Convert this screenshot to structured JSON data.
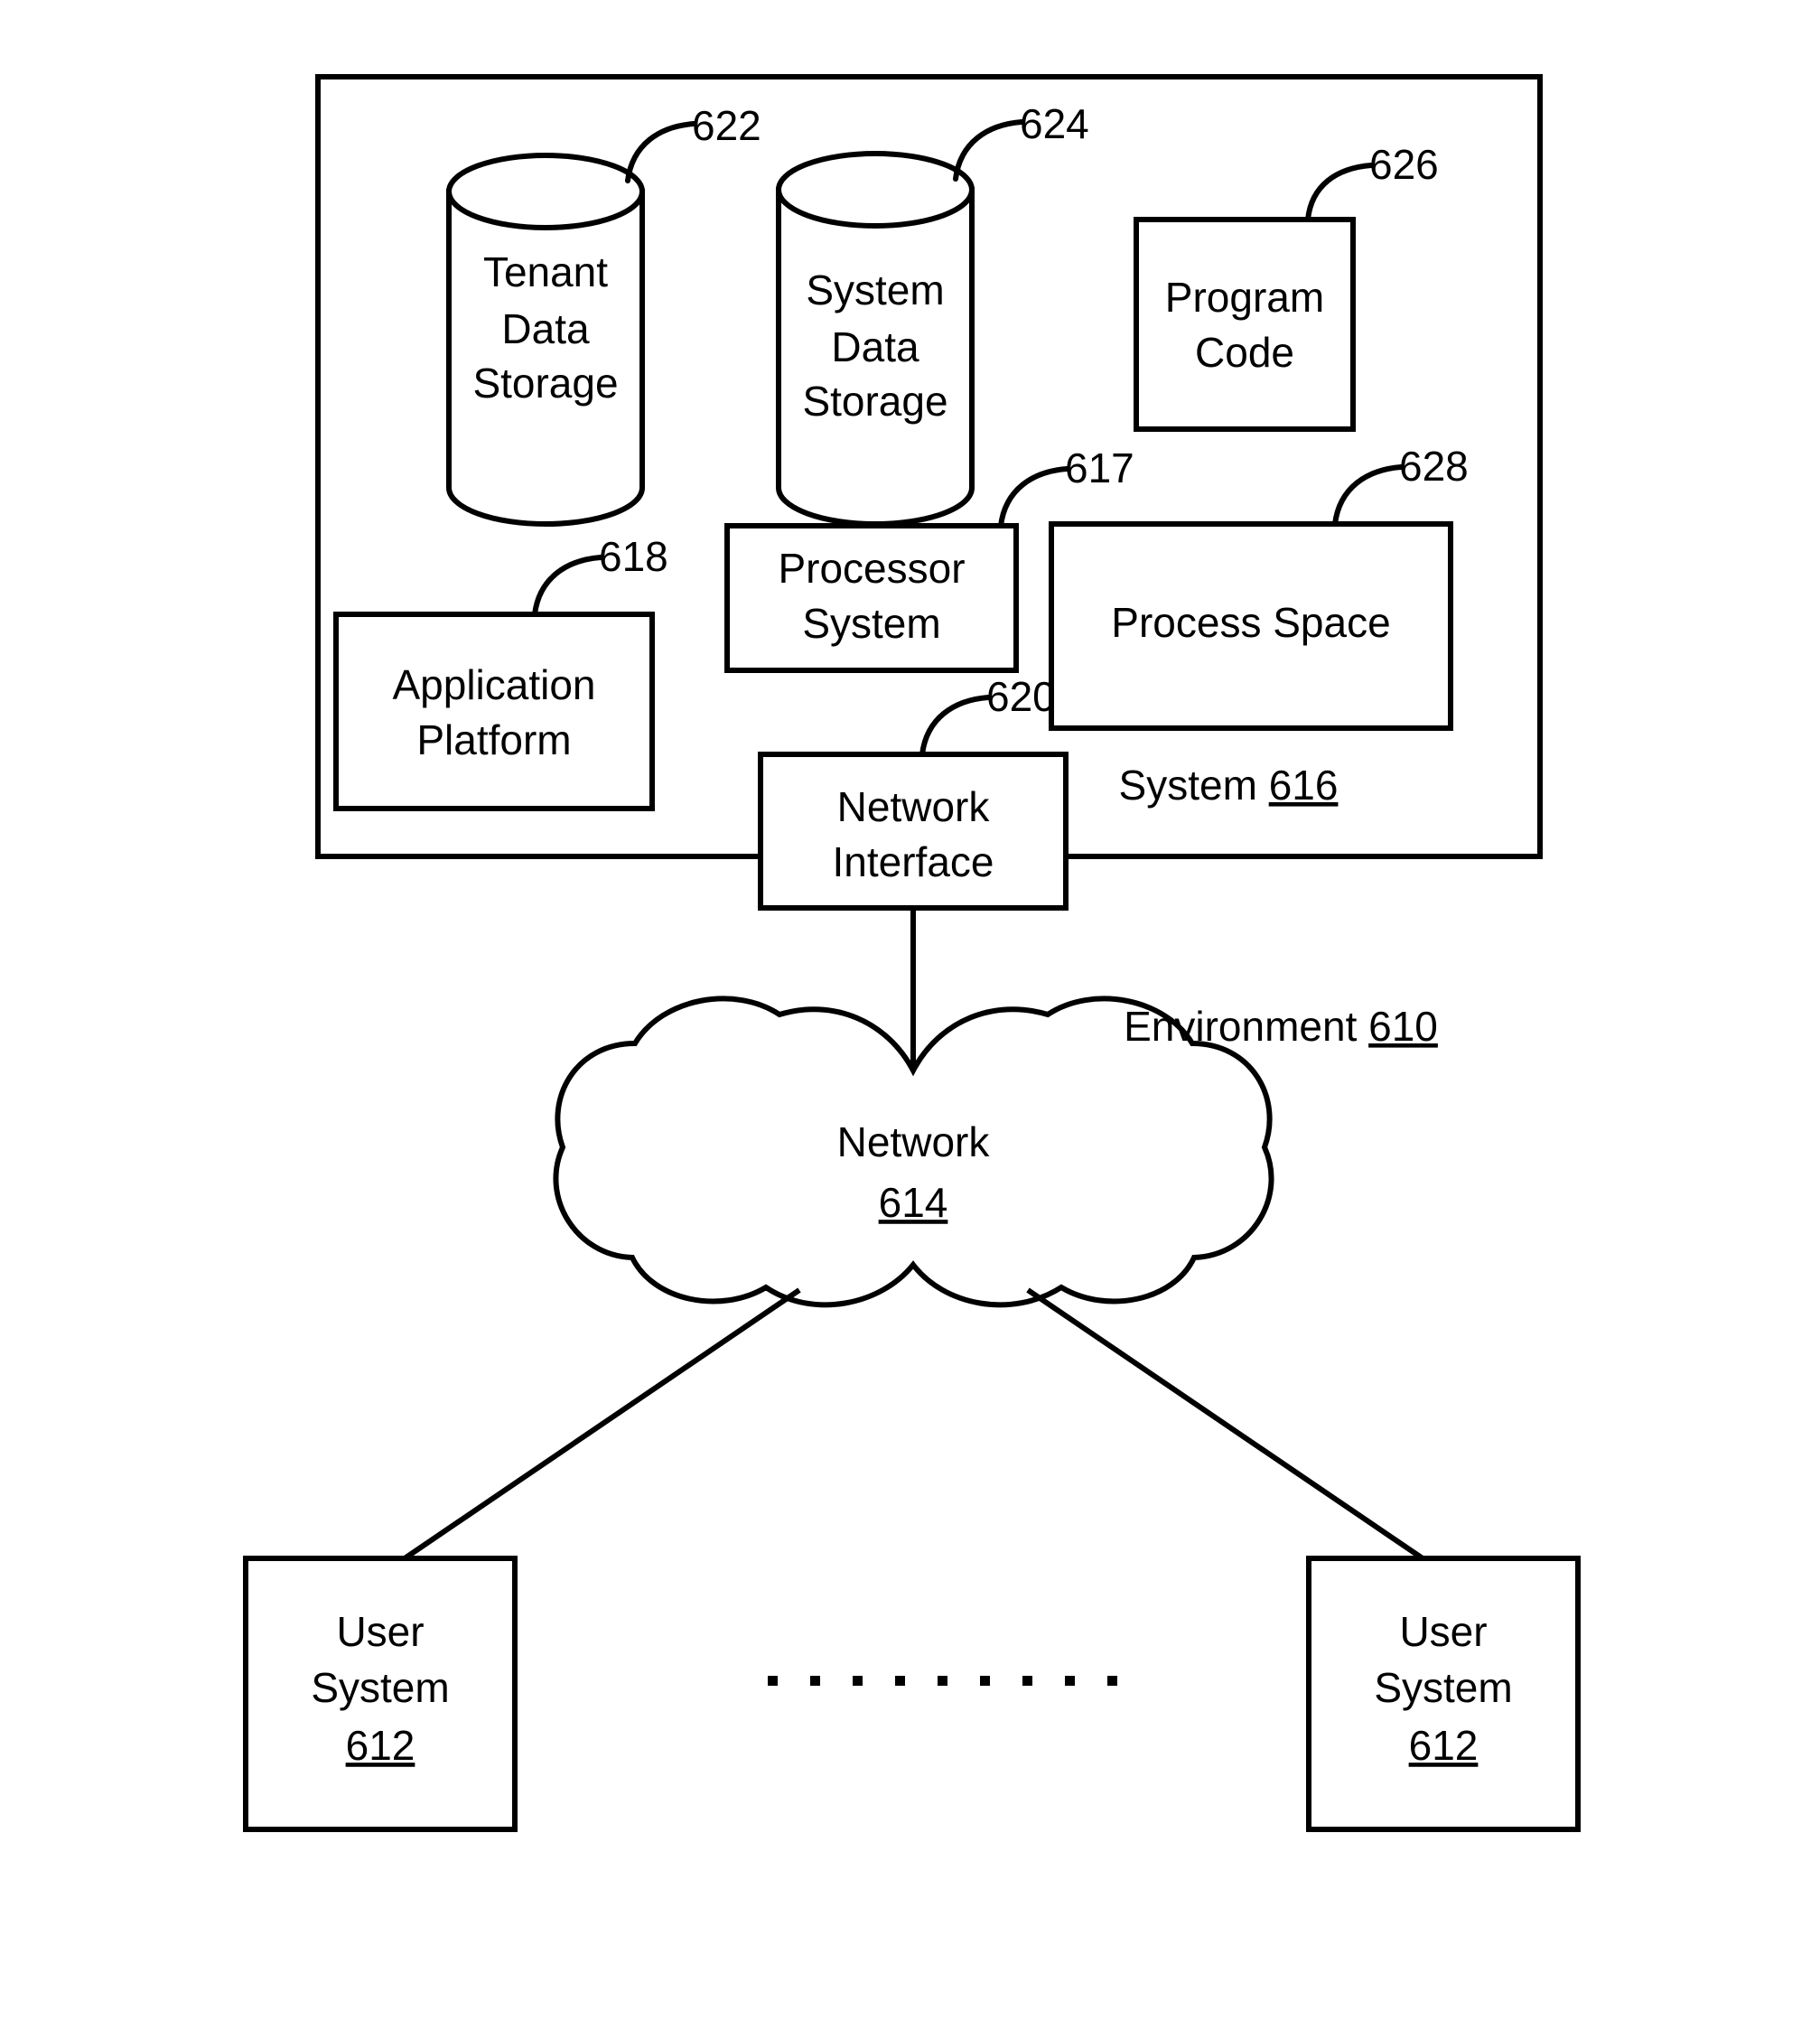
{
  "figure": {
    "environment_label": "Environment",
    "environment_ref": "610",
    "system_label": "System",
    "system_ref": "616"
  },
  "blocks": {
    "tenant_data_storage": {
      "label_line1": "Tenant",
      "label_line2": "Data",
      "label_line3": "Storage",
      "ref": "622",
      "shape": "cylinder"
    },
    "system_data_storage": {
      "label_line1": "System",
      "label_line2": "Data",
      "label_line3": "Storage",
      "ref": "624",
      "shape": "cylinder"
    },
    "program_code": {
      "label_line1": "Program",
      "label_line2": "Code",
      "ref": "626",
      "shape": "rectangle"
    },
    "processor_system": {
      "label_line1": "Processor",
      "label_line2": "System",
      "ref": "617",
      "shape": "rectangle"
    },
    "process_space": {
      "label_line1": "Process Space",
      "ref": "628",
      "shape": "rectangle"
    },
    "application_platform": {
      "label_line1": "Application",
      "label_line2": "Platform",
      "ref": "618",
      "shape": "rectangle"
    },
    "network_interface": {
      "label_line1": "Network",
      "label_line2": "Interface",
      "ref": "620",
      "shape": "rectangle"
    },
    "network_cloud": {
      "label_line1": "Network",
      "ref": "614",
      "shape": "cloud"
    },
    "user_system_left": {
      "label_line1": "User",
      "label_line2": "System",
      "ref": "612",
      "shape": "rectangle"
    },
    "user_system_right": {
      "label_line1": "User",
      "label_line2": "System",
      "ref": "612",
      "shape": "rectangle"
    }
  },
  "ellipsis": {
    "glyph": "·",
    "count": 9
  },
  "colors": {
    "stroke": "#000000",
    "fill": "#ffffff",
    "background": "#ffffff"
  }
}
